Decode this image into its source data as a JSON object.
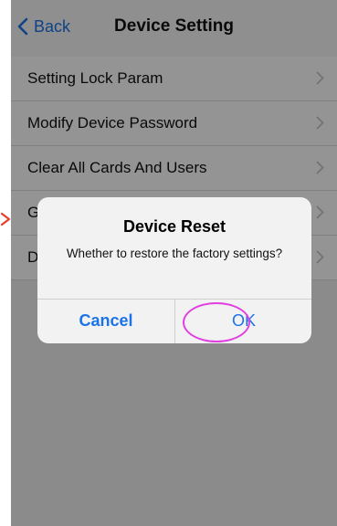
{
  "nav": {
    "back_label": "Back",
    "title": "Device Setting"
  },
  "list": {
    "items": [
      {
        "label": "Setting Lock Param"
      },
      {
        "label": "Modify Device Password"
      },
      {
        "label": "Clear All Cards And Users"
      },
      {
        "label": "G"
      },
      {
        "label": "D"
      }
    ]
  },
  "dialog": {
    "title": "Device Reset",
    "message": "Whether to restore the factory settings?",
    "cancel_label": "Cancel",
    "ok_label": "OK"
  },
  "colors": {
    "accent": "#1a73e8",
    "highlight": "#e040e0",
    "annotation": "#e8402a"
  }
}
